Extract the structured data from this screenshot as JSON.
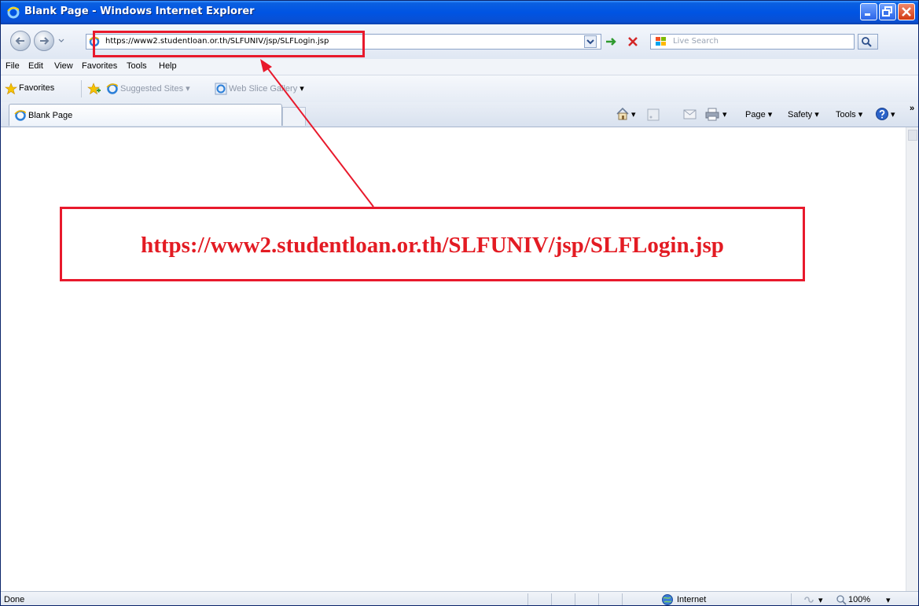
{
  "window": {
    "title": "Blank Page - Windows Internet Explorer"
  },
  "address": {
    "url": "https://www2.studentloan.or.th/SLFUNIV/jsp/SLFLogin.jsp"
  },
  "search": {
    "placeholder": "Live Search"
  },
  "menu": {
    "items": [
      "File",
      "Edit",
      "View",
      "Favorites",
      "Tools",
      "Help"
    ]
  },
  "favorites_bar": {
    "favorites_label": "Favorites",
    "suggested_sites": "Suggested Sites",
    "web_slice_gallery": "Web Slice Gallery"
  },
  "tab": {
    "label": "Blank Page"
  },
  "command_bar": {
    "page": "Page",
    "safety": "Safety",
    "tools": "Tools"
  },
  "annotation": {
    "url_text": "https://www2.studentloan.or.th/SLFUNIV/jsp/SLFLogin.jsp",
    "color": "#e8192c"
  },
  "status": {
    "left": "Done",
    "zone": "Internet",
    "zoom": "100%"
  }
}
